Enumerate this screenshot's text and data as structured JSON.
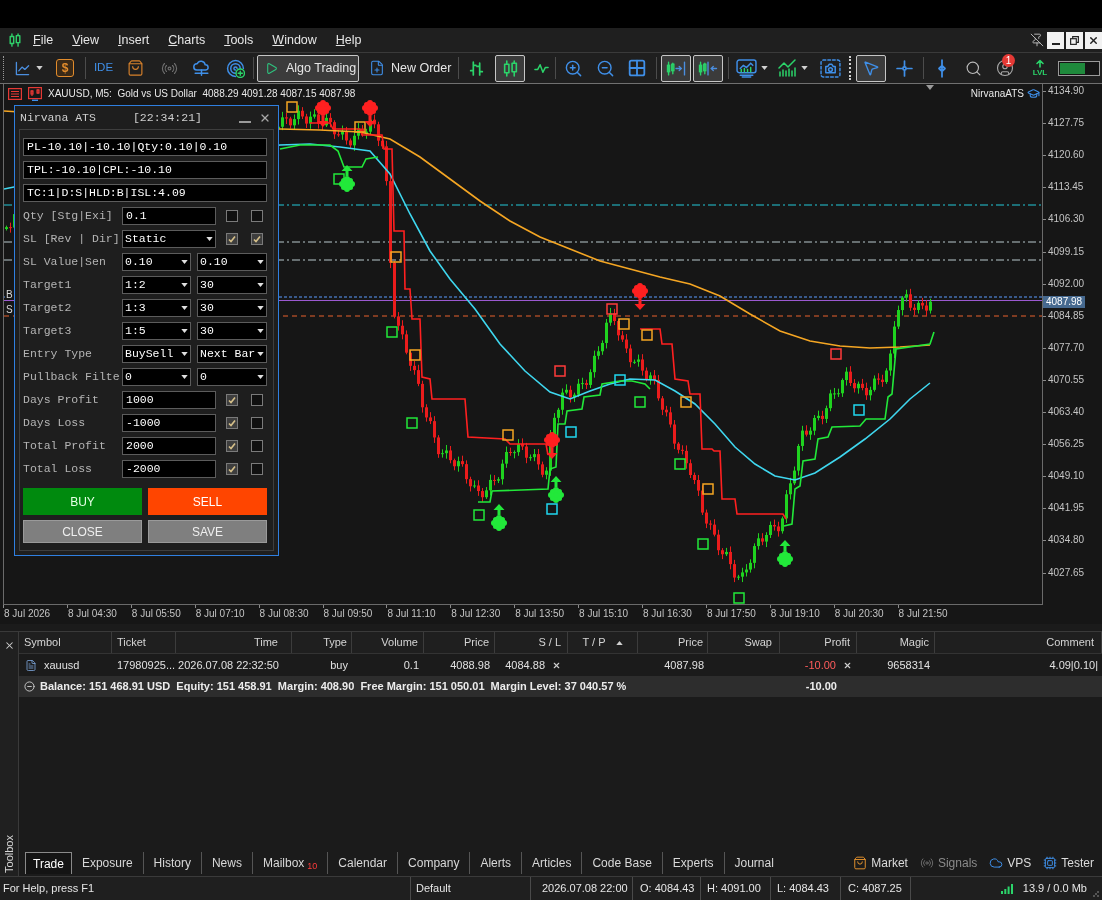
{
  "menu": {
    "items": [
      "File",
      "View",
      "Insert",
      "Charts",
      "Tools",
      "Window",
      "Help"
    ]
  },
  "toolbar": {
    "dollar_glyph": "$",
    "ide_label": "IDE",
    "algo_trading": {
      "label": "Algo Trading",
      "selected": true
    },
    "new_order_label": "New Order",
    "chart_types": [
      {
        "selected": false
      },
      {
        "selected": true
      },
      {
        "selected": false
      }
    ],
    "chart_shift": {
      "selected": true
    },
    "auto_scroll": {
      "selected": true
    },
    "pointer_modes": [
      {
        "selected": true
      },
      {
        "selected": false
      }
    ],
    "account_badge": "1",
    "lvl_label": "LVL",
    "meter": {
      "level": 0.65
    }
  },
  "chart": {
    "header": "XAUUSD, M5:  Gold vs US Dollar  4088.29 4091.28 4087.15 4087.98",
    "expert": "NirvanaATS",
    "line_labels": [
      "B",
      "S"
    ],
    "price_labels": [
      "4134.90",
      "4127.75",
      "4120.60",
      "4113.45",
      "4106.30",
      "4099.15",
      "4092.00",
      "4084.85",
      "4077.70",
      "4070.55",
      "4063.40",
      "4056.25",
      "4049.10",
      "4041.95",
      "4034.80",
      "4027.65"
    ],
    "current_price": "4087.98",
    "time_labels": [
      "8 Jul 2026",
      "8 Jul 04:30",
      "8 Jul 05:50",
      "8 Jul 07:10",
      "8 Jul 08:30",
      "8 Jul 09:50",
      "8 Jul 11:10",
      "8 Jul 12:30",
      "8 Jul 13:50",
      "8 Jul 15:10",
      "8 Jul 16:30",
      "8 Jul 17:50",
      "8 Jul 19:10",
      "8 Jul 20:30",
      "8 Jul 21:50"
    ]
  },
  "ats_panel": {
    "title": "Nirvana ATS",
    "clock": "[22:34:21]",
    "status_lines": [
      "PL-10.10|-10.10|Qty:0.10|0.10",
      "TPL:-10.10|CPL:-10.10",
      "TC:1|D:S|HLD:B|ISL:4.09"
    ],
    "rows": [
      {
        "kind": "input",
        "label": "Qty [Stg|Exi]",
        "value": "0.1",
        "checks": [
          {
            "checked": false
          },
          {
            "checked": false
          }
        ]
      },
      {
        "kind": "select",
        "label": "SL [Rev | Dir]",
        "value": "Static",
        "checks": [
          {
            "checked": true
          },
          {
            "checked": true
          }
        ]
      },
      {
        "kind": "pair",
        "label": "SL Value|Sen",
        "values": [
          "0.10",
          "0.10"
        ]
      },
      {
        "kind": "pair",
        "label": "Target1",
        "values": [
          "1:2",
          "30"
        ]
      },
      {
        "kind": "pair",
        "label": "Target2",
        "values": [
          "1:3",
          "30"
        ]
      },
      {
        "kind": "pair",
        "label": "Target3",
        "values": [
          "1:5",
          "30"
        ]
      },
      {
        "kind": "pair",
        "label": "Entry Type",
        "values": [
          "BuySell",
          "Next Bar"
        ]
      },
      {
        "kind": "pair",
        "label": "Pullback Filte",
        "values": [
          "0",
          "0"
        ]
      },
      {
        "kind": "input",
        "label": "Days Profit",
        "value": "1000",
        "checks": [
          {
            "checked": true
          },
          {
            "checked": false
          }
        ]
      },
      {
        "kind": "input",
        "label": "Days Loss",
        "value": "-1000",
        "checks": [
          {
            "checked": true
          },
          {
            "checked": false
          }
        ]
      },
      {
        "kind": "input",
        "label": "Total Profit",
        "value": "2000",
        "checks": [
          {
            "checked": true
          },
          {
            "checked": false
          }
        ]
      },
      {
        "kind": "input",
        "label": "Total Loss",
        "value": "-2000",
        "checks": [
          {
            "checked": true
          },
          {
            "checked": false
          }
        ]
      }
    ],
    "buttons": [
      {
        "kind": "buy",
        "label": "BUY"
      },
      {
        "kind": "sell",
        "label": "SELL"
      },
      {
        "kind": "plain",
        "label": "CLOSE"
      },
      {
        "kind": "plain",
        "label": "SAVE"
      }
    ]
  },
  "toolbox": {
    "title": "Toolbox",
    "columns": [
      {
        "label": "Symbol",
        "sorted": false
      },
      {
        "label": "Ticket",
        "sorted": false
      },
      {
        "label": "Time",
        "sorted": false
      },
      {
        "label": "Type",
        "sorted": false
      },
      {
        "label": "Volume",
        "sorted": false
      },
      {
        "label": "Price",
        "sorted": false
      },
      {
        "label": "S / L",
        "sorted": false
      },
      {
        "label": "T / P",
        "sorted": true
      },
      {
        "label": "Price",
        "sorted": false
      },
      {
        "label": "Swap",
        "sorted": false
      },
      {
        "label": "Profit",
        "sorted": false
      },
      {
        "label": "Magic",
        "sorted": false
      },
      {
        "label": "Comment",
        "sorted": false
      }
    ],
    "rows": [
      {
        "symbol": "xauusd",
        "ticket": "17980925...",
        "time": "2026.07.08 22:32:50",
        "type": "buy",
        "volume": "0.1",
        "open_price": "4088.98",
        "sl": "4084.88",
        "price": "4087.98",
        "profit": "-10.00",
        "magic": "9658314",
        "comment": "4.09|0.10|",
        "loss": true
      }
    ],
    "summary": {
      "expanded": true,
      "text": "Balance: 151 468.91 USD  Equity: 151 458.91  Margin: 408.90  Free Margin: 151 050.01  Margin Level: 37 040.57 %",
      "profit": "-10.00"
    },
    "tabs": [
      {
        "label": "Trade",
        "selected": true
      },
      {
        "label": "Exposure",
        "selected": false
      },
      {
        "label": "History",
        "selected": false
      },
      {
        "label": "News",
        "selected": false
      },
      {
        "label": "Mailbox",
        "selected": false,
        "badge": "10"
      },
      {
        "label": "Calendar",
        "selected": false
      },
      {
        "label": "Company",
        "selected": false
      },
      {
        "label": "Alerts",
        "selected": false
      },
      {
        "label": "Articles",
        "selected": false
      },
      {
        "label": "Code Base",
        "selected": false
      },
      {
        "label": "Experts",
        "selected": false
      },
      {
        "label": "Journal",
        "selected": false
      }
    ],
    "services": [
      {
        "label": "Market",
        "disabled": false
      },
      {
        "label": "Signals",
        "disabled": true
      },
      {
        "label": "VPS",
        "disabled": false
      },
      {
        "label": "Tester",
        "disabled": false
      }
    ]
  },
  "status_bar": {
    "help": "For Help, press F1",
    "profile": "Default",
    "bar_time": "2026.07.08 22:00",
    "open": "O: 4084.43",
    "high": "H: 4091.00",
    "low": "L: 4084.43",
    "close": "C: 4087.25",
    "traffic": "13.9 / 0.0 Mb"
  }
}
